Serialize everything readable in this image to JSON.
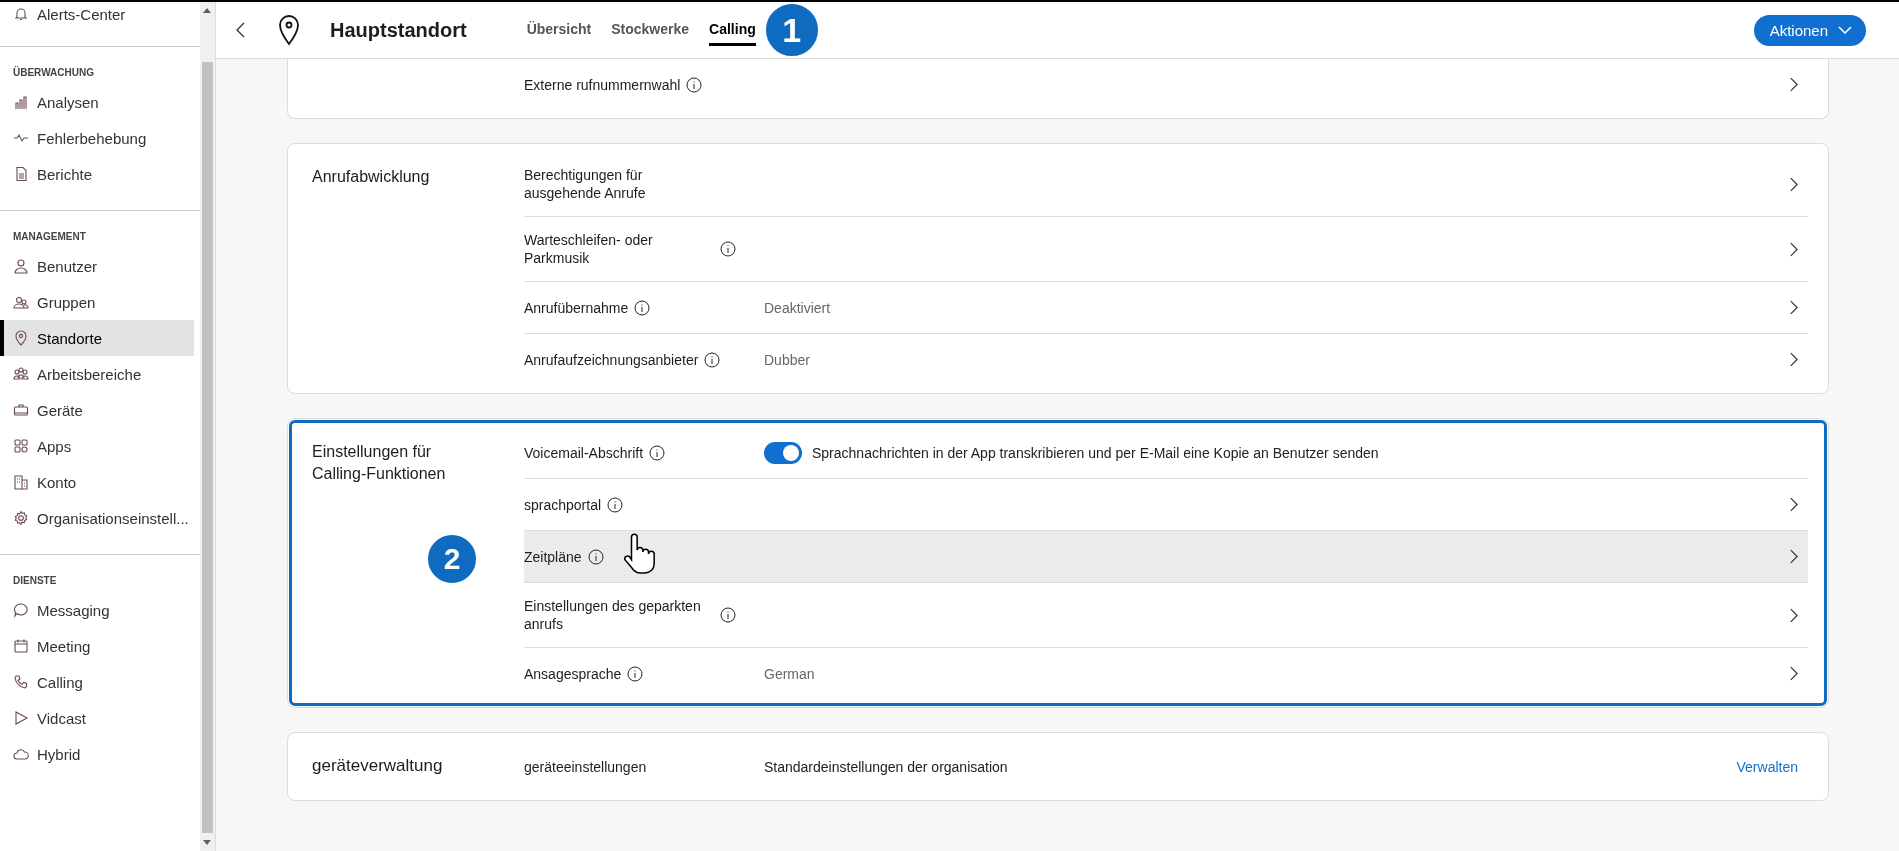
{
  "sidebar": {
    "top_item": {
      "label": "Alerts-Center"
    },
    "sections": [
      {
        "heading": "ÜBERWACHUNG",
        "items": [
          {
            "label": "Analysen",
            "selected": false
          },
          {
            "label": "Fehlerbehebung",
            "selected": false
          },
          {
            "label": "Berichte",
            "selected": false
          }
        ]
      },
      {
        "heading": "MANAGEMENT",
        "items": [
          {
            "label": "Benutzer",
            "selected": false
          },
          {
            "label": "Gruppen",
            "selected": false
          },
          {
            "label": "Standorte",
            "selected": true
          },
          {
            "label": "Arbeitsbereiche",
            "selected": false
          },
          {
            "label": "Geräte",
            "selected": false
          },
          {
            "label": "Apps",
            "selected": false
          },
          {
            "label": "Konto",
            "selected": false
          },
          {
            "label": "Organisationseinstell...",
            "selected": false
          }
        ]
      },
      {
        "heading": "DIENSTE",
        "items": [
          {
            "label": "Messaging",
            "selected": false
          },
          {
            "label": "Meeting",
            "selected": false
          },
          {
            "label": "Calling",
            "selected": false
          },
          {
            "label": "Vidcast",
            "selected": false
          },
          {
            "label": "Hybrid",
            "selected": false
          }
        ]
      }
    ]
  },
  "header": {
    "title": "Hauptstandort",
    "tabs": [
      {
        "label": "Übersicht",
        "selected": false
      },
      {
        "label": "Stockwerke",
        "selected": false
      },
      {
        "label": "Calling",
        "selected": true
      }
    ],
    "marker": "1",
    "action_button": "Aktionen"
  },
  "cards": [
    {
      "rows": [
        {
          "kind": "chevron",
          "label": "Externe rufnummernwahl",
          "info": true,
          "selected": false
        }
      ]
    },
    {
      "title": "Anrufabwicklung",
      "highlighted": false,
      "rows": [
        {
          "kind": "chevron",
          "label": "Berechtigungen für ausgehende Anrufe",
          "info": false,
          "selected": false
        },
        {
          "kind": "chevron",
          "label": "Warteschleifen- oder Parkmusik",
          "info": true,
          "selected": false
        },
        {
          "kind": "chevron",
          "label": "Anrufübernahme",
          "info": true,
          "value": "Deaktiviert",
          "selected": false
        },
        {
          "kind": "chevron",
          "label": "Anrufaufzeichnungsanbieter",
          "info": true,
          "value": "Dubber",
          "selected": false
        }
      ]
    },
    {
      "title": "Einstellungen für Calling-Funktionen",
      "highlighted": true,
      "marker": "2",
      "rows": [
        {
          "kind": "toggle",
          "label": "Voicemail-Abschrift",
          "info": true,
          "on": true,
          "value": "Sprachnachrichten in der App transkribieren und per E-Mail eine Kopie an Benutzer senden",
          "selected": false
        },
        {
          "kind": "chevron",
          "label": "sprachportal",
          "info": true,
          "selected": false
        },
        {
          "kind": "chevron",
          "label": "Zeitpläne",
          "info": true,
          "selected": true,
          "cursor": true
        },
        {
          "kind": "chevron",
          "label": "Einstellungen des geparkten anrufs",
          "info": true,
          "selected": false
        },
        {
          "kind": "chevron",
          "label": "Ansagesprache",
          "info": true,
          "value": "German",
          "selected": false
        }
      ]
    },
    {
      "title": "geräteverwaltung",
      "highlighted": false,
      "rows": [
        {
          "kind": "link",
          "label": "geräteeinstellungen",
          "info": false,
          "value": "Standardeinstellungen der organisation",
          "link": "Verwalten",
          "selected": false
        }
      ]
    }
  ]
}
